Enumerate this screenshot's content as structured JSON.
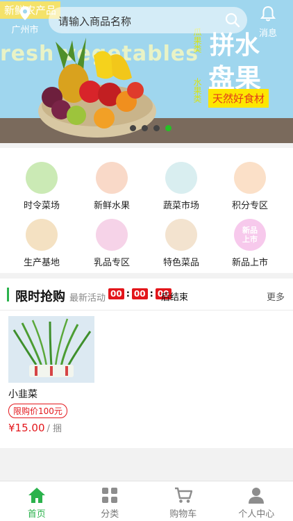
{
  "header": {
    "city": "广州市",
    "search_placeholder": "请输入商品名称",
    "message_label": "消息"
  },
  "banner": {
    "corner_text": "新鲜农产品",
    "english_text": "resh vegetables",
    "side_text_1": "瓜果类",
    "side_text_2": "水果类",
    "title_1": "拼水",
    "title_2": "盘果",
    "tagline": "天然好食材",
    "slide_count": 4,
    "active_slide": 4
  },
  "categories": [
    {
      "label": "时令菜场",
      "icon": "vegetable-icon",
      "color": "#cbeab5"
    },
    {
      "label": "新鲜水果",
      "icon": "fruit-icon",
      "color": "#f9d9c8"
    },
    {
      "label": "蔬菜市场",
      "icon": "market-icon",
      "color": "#d9eef0"
    },
    {
      "label": "积分专区",
      "icon": "coins-icon",
      "color": "#fbe0c8"
    },
    {
      "label": "生产基地",
      "icon": "farm-icon",
      "color": "#f4e1c2"
    },
    {
      "label": "乳品专区",
      "icon": "milk-icon",
      "color": "#f6d3e8"
    },
    {
      "label": "特色菜品",
      "icon": "dish-icon",
      "color": "#f3e3cf"
    },
    {
      "label": "新品上市",
      "icon": "new-products-icon",
      "color": "#f7c9ec",
      "icon_text": "新品上市"
    }
  ],
  "flash_sale": {
    "title": "限时抢购",
    "subtitle": "最新活动",
    "hours": "00",
    "minutes": "00",
    "seconds": "00",
    "ends_label": "后结束",
    "more_label": "更多"
  },
  "products": [
    {
      "name": "小韭菜",
      "tag": "限购价100元",
      "price": "¥15.00",
      "unit": "/ 捆"
    }
  ],
  "tabs": [
    {
      "label": "首页",
      "icon": "home-icon",
      "active": true
    },
    {
      "label": "分类",
      "icon": "grid-icon",
      "active": false
    },
    {
      "label": "购物车",
      "icon": "cart-icon",
      "active": false
    },
    {
      "label": "个人中心",
      "icon": "user-icon",
      "active": false
    }
  ],
  "colors": {
    "accent": "#2bb24c",
    "price": "#e3161b",
    "timer_bg": "#e3161b"
  }
}
